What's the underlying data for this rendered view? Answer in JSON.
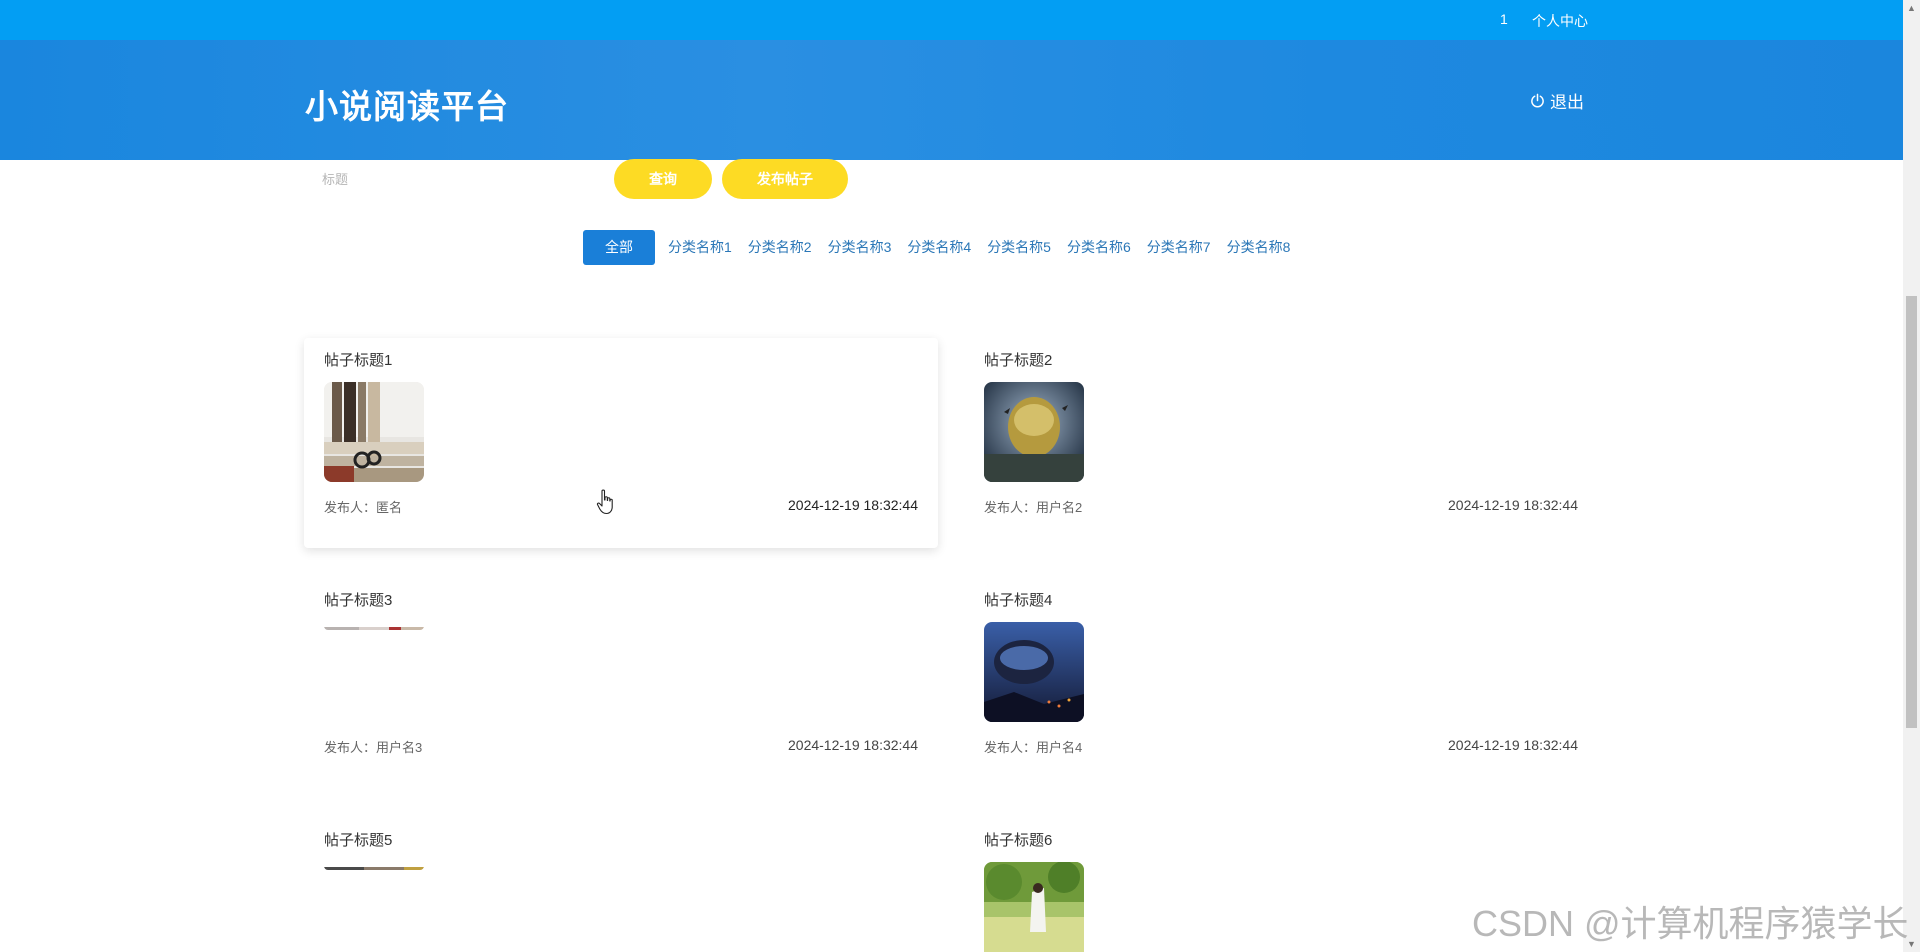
{
  "topbar": {
    "count": "1",
    "user_center": "个人中心"
  },
  "header": {
    "brand": "小说阅读平台",
    "logout": "退出"
  },
  "search": {
    "placeholder": "标题",
    "query_label": "查询",
    "post_label": "发布帖子"
  },
  "categories": [
    "全部",
    "分类名称1",
    "分类名称2",
    "分类名称3",
    "分类名称4",
    "分类名称5",
    "分类名称6",
    "分类名称7",
    "分类名称8"
  ],
  "active_category": "全部",
  "posts": [
    {
      "title": "帖子标题1",
      "author": "发布人：匿名",
      "time": "2024-12-19 18:32:44"
    },
    {
      "title": "帖子标题2",
      "author": "发布人：用户名2",
      "time": "2024-12-19 18:32:44"
    },
    {
      "title": "帖子标题3",
      "author": "发布人：用户名3",
      "time": "2024-12-19 18:32:44"
    },
    {
      "title": "帖子标题4",
      "author": "发布人：用户名4",
      "time": "2024-12-19 18:32:44"
    },
    {
      "title": "帖子标题5"
    },
    {
      "title": "帖子标题6"
    }
  ],
  "watermark": "CSDN @计算机程序猿学长",
  "colors": {
    "topbar": "#039ef3",
    "header": "#1e88e0",
    "accent_yellow": "#fddb24",
    "tab_active": "#1a7fd8",
    "tab_text": "#2b77b7"
  }
}
